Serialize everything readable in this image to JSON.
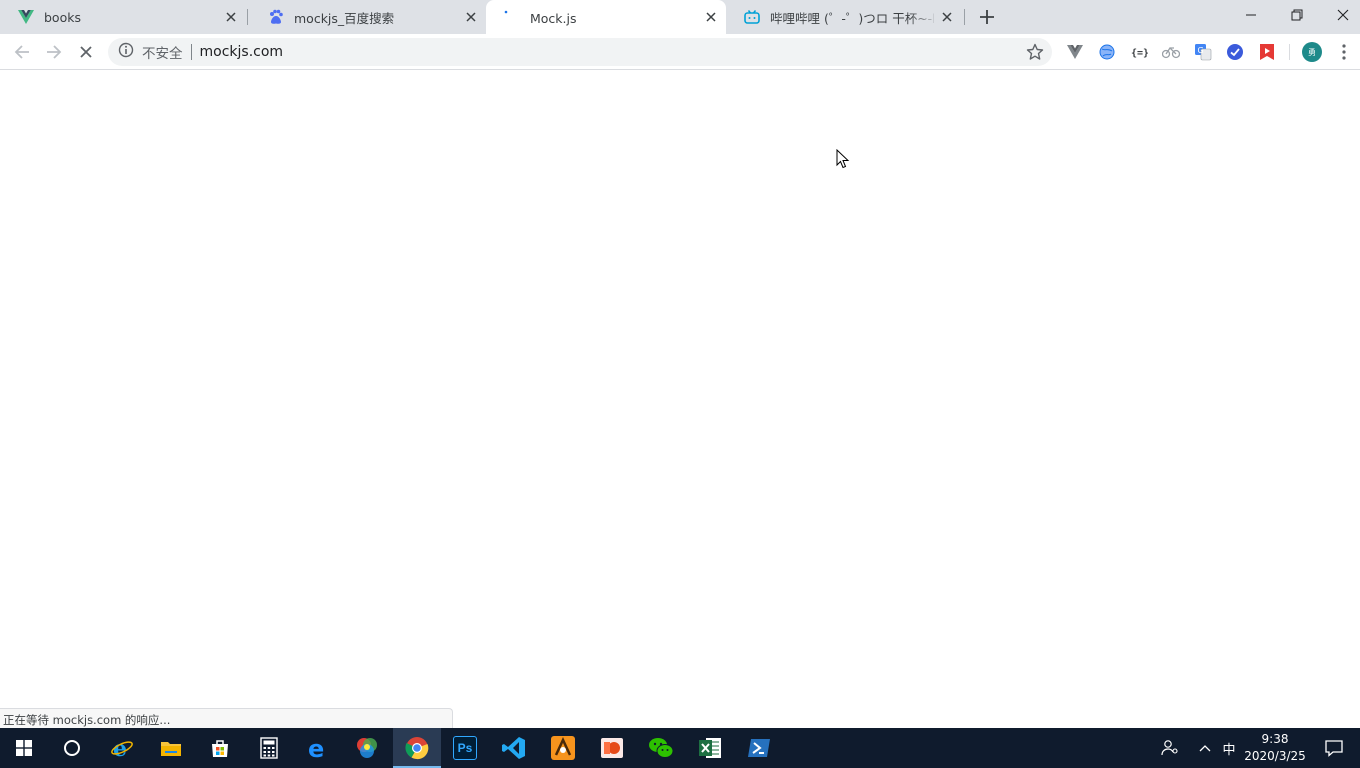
{
  "tabs": [
    {
      "title": "books",
      "icon": "vue-icon",
      "active": false
    },
    {
      "title": "mockjs_百度搜索",
      "icon": "baidu-icon",
      "active": false
    },
    {
      "title": "Mock.js",
      "icon": "loading-icon",
      "active": true
    },
    {
      "title": "哔哩哔哩 (゜-゜)つロ 干杯~-bilibili",
      "icon": "bilibili-icon",
      "active": false
    }
  ],
  "omnibox": {
    "security_label": "不安全",
    "url": "mockjs.com"
  },
  "extensions": [
    "vue-devtools-icon",
    "extension-globe-icon",
    "json-formatter-icon",
    "extension-bike-icon",
    "google-translate-icon",
    "extension-check-icon",
    "extension-video-icon"
  ],
  "profile": {
    "initial": "勇"
  },
  "status_bar": {
    "text": "正在等待 mockjs.com 的响应..."
  },
  "taskbar": {
    "apps": [
      "internet-explorer-icon",
      "file-explorer-icon",
      "store-icon",
      "calculator-icon",
      "edge-icon",
      "colorful-app-icon",
      "chrome-icon",
      "photoshop-icon",
      "vscode-icon",
      "app-orange-icon",
      "app-red-icon",
      "wechat-icon",
      "excel-icon",
      "powershell-icon"
    ],
    "ps_label": "Ps",
    "input_method": "中",
    "time": "9:38",
    "date": "2020/3/25"
  },
  "colors": {
    "tab_bg": "#dee1e6",
    "taskbar_bg": "#0f1b2d",
    "accent": "#76b9ed"
  }
}
